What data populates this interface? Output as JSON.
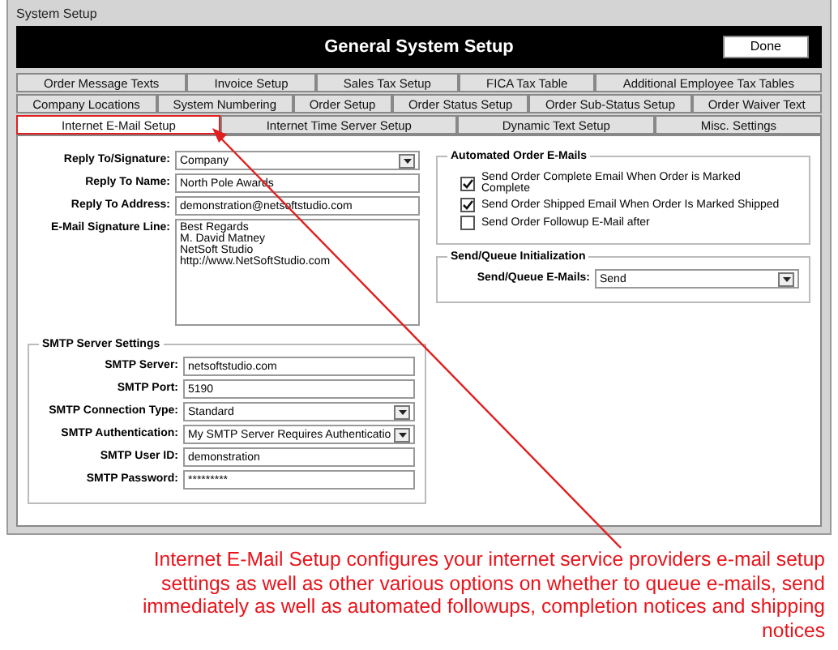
{
  "window": {
    "title": "System Setup"
  },
  "header": {
    "title": "General System Setup",
    "done_button": "Done"
  },
  "tab_rows": [
    {
      "tabs": [
        {
          "label": "Order Message Texts",
          "selected": false
        },
        {
          "label": "Invoice Setup",
          "selected": false
        },
        {
          "label": "Sales Tax Setup",
          "selected": false
        },
        {
          "label": "FICA Tax Table",
          "selected": false
        },
        {
          "label": "Additional Employee Tax Tables",
          "selected": false
        }
      ]
    },
    {
      "tabs": [
        {
          "label": "Company Locations",
          "selected": false
        },
        {
          "label": "System Numbering",
          "selected": false
        },
        {
          "label": "Order Setup",
          "selected": false
        },
        {
          "label": "Order Status Setup",
          "selected": false
        },
        {
          "label": "Order Sub-Status Setup",
          "selected": false
        },
        {
          "label": "Order Waiver Text",
          "selected": false
        }
      ]
    },
    {
      "tabs": [
        {
          "label": "Internet E-Mail Setup",
          "selected": true
        },
        {
          "label": "Internet Time Server Setup",
          "selected": false
        },
        {
          "label": "Dynamic Text Setup",
          "selected": false
        },
        {
          "label": "Misc. Settings",
          "selected": false
        }
      ]
    }
  ],
  "reply_fields": [
    {
      "label": "Reply To/Signature:",
      "kind": "dropdown",
      "value": "Company"
    },
    {
      "label": "Reply To Name:",
      "kind": "text",
      "value": "North Pole Awards"
    },
    {
      "label": "Reply To Address:",
      "kind": "text",
      "value": "demonstration@netsoftstudio.com"
    },
    {
      "label": "E-Mail Signature Line:",
      "kind": "textarea",
      "lines": [
        "Best Regards",
        "M. David Matney",
        "NetSoft Studio",
        "http://www.NetSoftStudio.com"
      ]
    }
  ],
  "smtp_settings": {
    "title": "SMTP Server Settings",
    "fields": [
      {
        "label": "SMTP Server:",
        "kind": "text",
        "value": "netsoftstudio.com"
      },
      {
        "label": "SMTP Port:",
        "kind": "text",
        "value": "5190"
      },
      {
        "label": "SMTP Connection Type:",
        "kind": "dropdown",
        "value": "Standard"
      },
      {
        "label": "SMTP Authentication:",
        "kind": "dropdown",
        "value": "My SMTP Server Requires Authenticatio"
      },
      {
        "label": "SMTP User ID:",
        "kind": "text",
        "value": "demonstration"
      },
      {
        "label": "SMTP Password:",
        "kind": "text",
        "value": "*********"
      }
    ]
  },
  "automated_emails": {
    "title": "Automated Order E-Mails",
    "options": [
      {
        "label": "Send Order Complete Email When Order is Marked Complete",
        "checked": true
      },
      {
        "label": "Send Order Shipped Email When Order Is Marked Shipped",
        "checked": true
      },
      {
        "label": "Send Order Followup E-Mail after",
        "checked": false
      }
    ]
  },
  "send_queue": {
    "title": "Send/Queue Initialization",
    "label": "Send/Queue E-Mails:",
    "value": "Send"
  },
  "annotation": "Internet E-Mail Setup configures your internet service providers e-mail setup settings as well as other various options on whether to queue e-mails, send immediately as well as automated followups, completion notices and shipping notices"
}
